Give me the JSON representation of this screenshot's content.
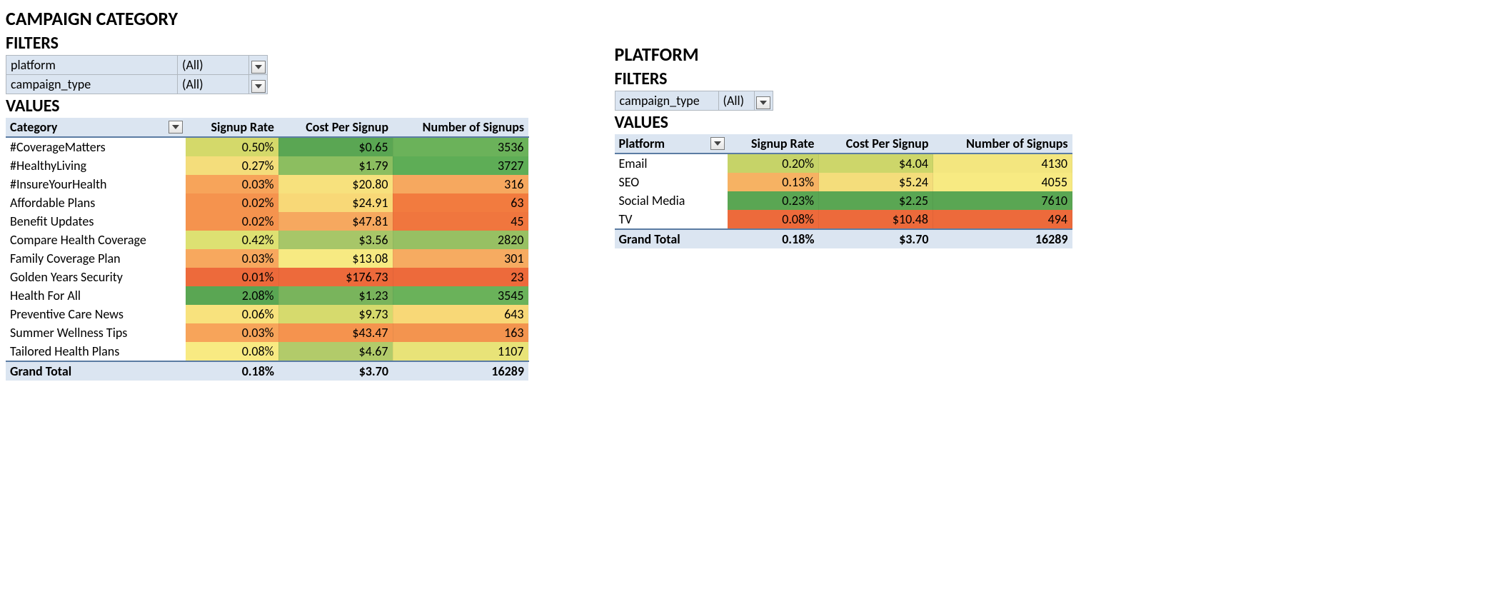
{
  "left": {
    "main_title": "CAMPAIGN CATEGORY",
    "filters_title": "FILTERS",
    "filters": [
      {
        "label": "platform",
        "value": "(All)"
      },
      {
        "label": "campaign_type",
        "value": "(All)"
      }
    ],
    "values_title": "VALUES",
    "headers": [
      "Category",
      "Signup Rate",
      "Cost Per Signup",
      "Number of Signups"
    ],
    "rows": [
      {
        "label": "#CoverageMatters",
        "rate": "0.50%",
        "cost": "$0.65",
        "signups": "3536",
        "c1": "#d4d96a",
        "c2": "#5aa653",
        "c3": "#6bb25a"
      },
      {
        "label": "#HealthyLiving",
        "rate": "0.27%",
        "cost": "$1.79",
        "signups": "3727",
        "c1": "#f4dd7b",
        "c2": "#8cbe60",
        "c3": "#5ead56"
      },
      {
        "label": "#InsureYourHealth",
        "rate": "0.03%",
        "cost": "$20.80",
        "signups": "316",
        "c1": "#f7a45a",
        "c2": "#f7e17d",
        "c3": "#f6a85f"
      },
      {
        "label": "Affordable Plans",
        "rate": "0.02%",
        "cost": "$24.91",
        "signups": "63",
        "c1": "#f5934e",
        "c2": "#f8d877",
        "c3": "#f27b3f"
      },
      {
        "label": "Benefit Updates",
        "rate": "0.02%",
        "cost": "$47.81",
        "signups": "45",
        "c1": "#f5934e",
        "c2": "#f6a85f",
        "c3": "#f0763e"
      },
      {
        "label": "Compare Health Coverage",
        "rate": "0.42%",
        "cost": "$3.56",
        "signups": "2820",
        "c1": "#dde172",
        "c2": "#a7c668",
        "c3": "#97c063"
      },
      {
        "label": "Family Coverage Plan",
        "rate": "0.03%",
        "cost": "$13.08",
        "signups": "301",
        "c1": "#f7a85e",
        "c2": "#f7ea82",
        "c3": "#f6ab61"
      },
      {
        "label": "Golden Years Security",
        "rate": "0.01%",
        "cost": "$176.73",
        "signups": "23",
        "c1": "#ed6a3b",
        "c2": "#ed6a3b",
        "c3": "#ed6a3b"
      },
      {
        "label": "Health For All",
        "rate": "2.08%",
        "cost": "$1.23",
        "signups": "3545",
        "c1": "#5aa653",
        "c2": "#79b45c",
        "c3": "#6ab25a"
      },
      {
        "label": "Preventive Care News",
        "rate": "0.06%",
        "cost": "$9.73",
        "signups": "643",
        "c1": "#f8e27d",
        "c2": "#d6da6d",
        "c3": "#f8d877"
      },
      {
        "label": "Summer Wellness Tips",
        "rate": "0.03%",
        "cost": "$43.47",
        "signups": "163",
        "c1": "#f7a45a",
        "c2": "#f5934e",
        "c3": "#f3944f"
      },
      {
        "label": "Tailored Health Plans",
        "rate": "0.08%",
        "cost": "$4.67",
        "signups": "1107",
        "c1": "#f8ea82",
        "c2": "#b2cb6a",
        "c3": "#e8e378"
      }
    ],
    "total": {
      "label": "Grand Total",
      "rate": "0.18%",
      "cost": "$3.70",
      "signups": "16289"
    }
  },
  "right": {
    "main_title": "PLATFORM",
    "filters_title": "FILTERS",
    "filters": [
      {
        "label": "campaign_type",
        "value": "(All)"
      }
    ],
    "values_title": "VALUES",
    "headers": [
      "Platform",
      "Signup Rate",
      "Cost Per Signup",
      "Number of Signups"
    ],
    "rows": [
      {
        "label": "Email",
        "rate": "0.20%",
        "cost": "$4.04",
        "signups": "4130",
        "c1": "#c6d368",
        "c2": "#cdd66a",
        "c3": "#f3e67f"
      },
      {
        "label": "SEO",
        "rate": "0.13%",
        "cost": "$5.24",
        "signups": "4055",
        "c1": "#f6b263",
        "c2": "#f4dd7b",
        "c3": "#f7ea82"
      },
      {
        "label": "Social Media",
        "rate": "0.23%",
        "cost": "$2.25",
        "signups": "7610",
        "c1": "#5aa653",
        "c2": "#5aa653",
        "c3": "#5aa653"
      },
      {
        "label": "TV",
        "rate": "0.08%",
        "cost": "$10.48",
        "signups": "494",
        "c1": "#ed6a3b",
        "c2": "#ed6a3b",
        "c3": "#ed6a3b"
      }
    ],
    "total": {
      "label": "Grand Total",
      "rate": "0.18%",
      "cost": "$3.70",
      "signups": "16289"
    }
  }
}
